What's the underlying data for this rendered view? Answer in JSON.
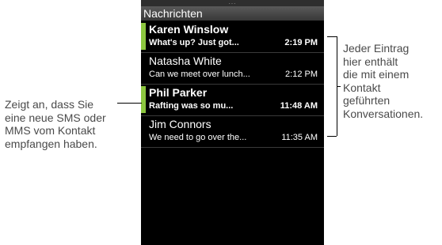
{
  "app": {
    "handle": "...",
    "title": "Nachrichten"
  },
  "threads": [
    {
      "name": "Karen Winslow",
      "preview": "What's up? Just got...",
      "time": "2:19 PM",
      "unread": true
    },
    {
      "name": "Natasha White",
      "preview": "Can we meet over lunch...",
      "time": "2:12 PM",
      "unread": false
    },
    {
      "name": "Phil Parker",
      "preview": "Rafting was so mu...",
      "time": "11:48 AM",
      "unread": true
    },
    {
      "name": "Jim Connors",
      "preview": "We need to go over the...",
      "time": "11:35 AM",
      "unread": false
    }
  ],
  "annotations": {
    "left": [
      "Zeigt an, dass Sie",
      "eine neue SMS oder",
      "MMS vom Kontakt",
      "empfangen haben."
    ],
    "right": [
      "Jeder Eintrag",
      "hier enthält",
      "die mit einem",
      "Kontakt",
      "geführten",
      "Konversationen."
    ]
  },
  "colors": {
    "unread_indicator": "#8cc63f",
    "header_bg": "#4a4a4a",
    "list_bg": "#000000"
  }
}
